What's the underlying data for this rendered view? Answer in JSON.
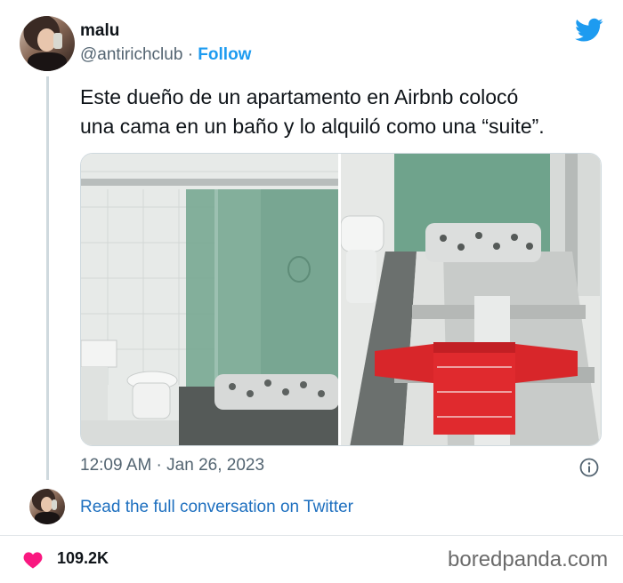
{
  "tweet": {
    "display_name": "malu",
    "handle": "@antirichclub",
    "separator": "·",
    "follow_label": "Follow",
    "text_line1": "Este dueño de un apartamento en Airbnb colocó",
    "text_line2": "una cama en un baño y lo alquiló como una “suite”.",
    "timestamp": "12:09 AM · Jan 26, 2023",
    "read_link": "Read the full conversation on Twitter",
    "likes": "109.2K"
  },
  "footer": {
    "watermark": "boredpanda.com"
  },
  "icons": {
    "brand": "twitter-bird-icon",
    "info": "info-icon",
    "like": "heart-icon"
  },
  "colors": {
    "accent": "#1d9bf0",
    "link": "#1d6fbf",
    "heart": "#f91880",
    "muted": "#536471"
  }
}
